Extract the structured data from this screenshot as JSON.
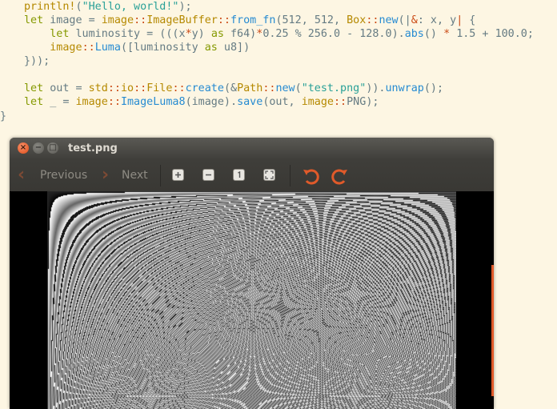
{
  "code": {
    "lines": [
      {
        "id": "l1",
        "parts": [
          {
            "t": "println!",
            "c": "mac"
          },
          {
            "t": "(",
            "c": ""
          },
          {
            "t": "\"Hello, world!\"",
            "c": "str"
          },
          {
            "t": ");",
            "c": ""
          }
        ]
      },
      {
        "id": "l2",
        "parts": [
          {
            "t": "let",
            "c": "kw"
          },
          {
            "t": " image = ",
            "c": ""
          },
          {
            "t": "image",
            "c": "ty"
          },
          {
            "t": "::",
            "c": "op"
          },
          {
            "t": "ImageBuffer",
            "c": "ty"
          },
          {
            "t": "::",
            "c": "op"
          },
          {
            "t": "from_fn",
            "c": "fn"
          },
          {
            "t": "(",
            "c": ""
          },
          {
            "t": "512",
            "c": ""
          },
          {
            "t": ", ",
            "c": ""
          },
          {
            "t": "512",
            "c": ""
          },
          {
            "t": ", ",
            "c": ""
          },
          {
            "t": "Box",
            "c": "ty"
          },
          {
            "t": "::",
            "c": "op"
          },
          {
            "t": "new",
            "c": "fn"
          },
          {
            "t": "(|",
            "c": ""
          },
          {
            "t": "&",
            "c": "op"
          },
          {
            "t": ": x, y",
            "c": ""
          },
          {
            "t": "|",
            "c": "op"
          },
          {
            "t": " {",
            "c": ""
          }
        ]
      },
      {
        "id": "l3",
        "parts": [
          {
            "t": "    let",
            "c": "kw"
          },
          {
            "t": " luminosity = (((x",
            "c": ""
          },
          {
            "t": "*",
            "c": "op"
          },
          {
            "t": "y) ",
            "c": ""
          },
          {
            "t": "as",
            "c": "kw"
          },
          {
            "t": " f64)",
            "c": ""
          },
          {
            "t": "*",
            "c": "op"
          },
          {
            "t": "0.25",
            "c": ""
          },
          {
            "t": " % ",
            "c": ""
          },
          {
            "t": "256.0",
            "c": ""
          },
          {
            "t": " - ",
            "c": ""
          },
          {
            "t": "128.0",
            "c": ""
          },
          {
            "t": ").",
            "c": ""
          },
          {
            "t": "abs",
            "c": "fn"
          },
          {
            "t": "() ",
            "c": ""
          },
          {
            "t": "*",
            "c": "op"
          },
          {
            "t": " ",
            "c": ""
          },
          {
            "t": "1.5",
            "c": ""
          },
          {
            "t": " + ",
            "c": ""
          },
          {
            "t": "100.0",
            "c": ""
          },
          {
            "t": ";",
            "c": ""
          }
        ]
      },
      {
        "id": "l4",
        "parts": [
          {
            "t": "    image",
            "c": "ty"
          },
          {
            "t": "::",
            "c": "op"
          },
          {
            "t": "Luma",
            "c": "fn"
          },
          {
            "t": "([luminosity ",
            "c": ""
          },
          {
            "t": "as",
            "c": "kw"
          },
          {
            "t": " u8])",
            "c": ""
          }
        ]
      },
      {
        "id": "l5",
        "parts": [
          {
            "t": "}));",
            "c": ""
          }
        ]
      },
      {
        "id": "l6",
        "parts": []
      },
      {
        "id": "l7",
        "parts": [
          {
            "t": "let",
            "c": "kw"
          },
          {
            "t": " out = ",
            "c": ""
          },
          {
            "t": "std",
            "c": "ty"
          },
          {
            "t": "::",
            "c": "op"
          },
          {
            "t": "io",
            "c": "ty"
          },
          {
            "t": "::",
            "c": "op"
          },
          {
            "t": "File",
            "c": "ty"
          },
          {
            "t": "::",
            "c": "op"
          },
          {
            "t": "create",
            "c": "fn"
          },
          {
            "t": "(&",
            "c": ""
          },
          {
            "t": "Path",
            "c": "ty"
          },
          {
            "t": "::",
            "c": "op"
          },
          {
            "t": "new",
            "c": "fn"
          },
          {
            "t": "(",
            "c": ""
          },
          {
            "t": "\"test.png\"",
            "c": "str"
          },
          {
            "t": ")).",
            "c": ""
          },
          {
            "t": "unwrap",
            "c": "fn"
          },
          {
            "t": "();",
            "c": ""
          }
        ]
      },
      {
        "id": "l8",
        "parts": [
          {
            "t": "let",
            "c": "kw"
          },
          {
            "t": " _ = ",
            "c": ""
          },
          {
            "t": "image",
            "c": "ty"
          },
          {
            "t": "::",
            "c": "op"
          },
          {
            "t": "ImageLuma8",
            "c": "fn"
          },
          {
            "t": "(image).",
            "c": ""
          },
          {
            "t": "save",
            "c": "fn"
          },
          {
            "t": "(out, ",
            "c": ""
          },
          {
            "t": "image",
            "c": "ty"
          },
          {
            "t": "::",
            "c": "op"
          },
          {
            "t": "PNG",
            "c": ""
          },
          {
            "t": ");",
            "c": ""
          }
        ]
      }
    ],
    "closing_brace": "}"
  },
  "window": {
    "title": "test.png",
    "close_glyph": "×",
    "min_glyph": "−",
    "max_glyph": "□"
  },
  "toolbar": {
    "previous_label": "Previous",
    "next_label": "Next",
    "prev_icon": "chevron-left-icon",
    "next_icon": "chevron-right-icon",
    "zoom_in_icon": "zoom-in-icon",
    "zoom_out_icon": "zoom-out-icon",
    "normal_size_icon": "normal-size-icon",
    "best_fit_icon": "best-fit-icon",
    "rotate_left_icon": "rotate-counterclockwise-icon",
    "rotate_right_icon": "rotate-clockwise-icon"
  },
  "colors": {
    "accent": "#e05a2a",
    "titlebar": "#3c3b37",
    "editor_bg": "#fdf6e3"
  }
}
